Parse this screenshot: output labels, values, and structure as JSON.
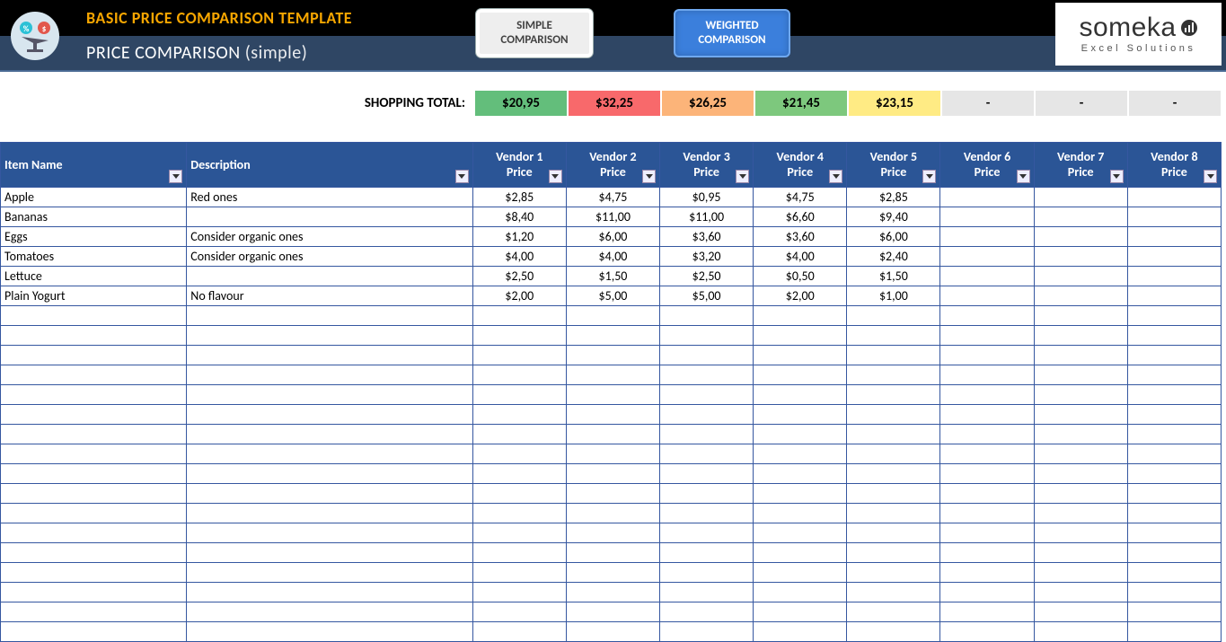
{
  "header": {
    "template_title": "BASIC PRICE COMPARISON TEMPLATE",
    "page_title": "PRICE COMPARISON",
    "page_title_suffix": "(simple)",
    "brand_name": "someka",
    "brand_sub": "Excel Solutions"
  },
  "modes": {
    "simple_line1": "SIMPLE",
    "simple_line2": "COMPARISON",
    "weighted_line1": "WEIGHTED",
    "weighted_line2": "COMPARISON"
  },
  "totals": {
    "label": "SHOPPING TOTAL:",
    "values": [
      "$20,95",
      "$32,25",
      "$26,25",
      "$21,45",
      "$23,15",
      "-",
      "-",
      "-"
    ],
    "colors": [
      "c-green",
      "c-red",
      "c-orange",
      "c-green2",
      "c-yellow",
      "c-grey",
      "c-grey",
      "c-grey"
    ]
  },
  "columns": {
    "item": "Item Name",
    "desc": "Description",
    "vendor_word": "Vendor",
    "price_word": "Price",
    "count": 8
  },
  "rows": [
    {
      "name": "Apple",
      "desc": "Red ones",
      "prices": [
        "$2,85",
        "$4,75",
        "$0,95",
        "$4,75",
        "$2,85",
        "",
        "",
        ""
      ]
    },
    {
      "name": "Bananas",
      "desc": "",
      "prices": [
        "$8,40",
        "$11,00",
        "$11,00",
        "$6,60",
        "$9,40",
        "",
        "",
        ""
      ]
    },
    {
      "name": "Eggs",
      "desc": "Consider organic ones",
      "prices": [
        "$1,20",
        "$6,00",
        "$3,60",
        "$3,60",
        "$6,00",
        "",
        "",
        ""
      ]
    },
    {
      "name": "Tomatoes",
      "desc": "Consider organic ones",
      "prices": [
        "$4,00",
        "$4,00",
        "$3,20",
        "$4,00",
        "$2,40",
        "",
        "",
        ""
      ]
    },
    {
      "name": "Lettuce",
      "desc": "",
      "prices": [
        "$2,50",
        "$1,50",
        "$2,50",
        "$0,50",
        "$1,50",
        "",
        "",
        ""
      ]
    },
    {
      "name": "Plain Yogurt",
      "desc": "No flavour",
      "prices": [
        "$2,00",
        "$5,00",
        "$5,00",
        "$2,00",
        "$1,00",
        "",
        "",
        ""
      ]
    }
  ],
  "empty_rows": 17
}
